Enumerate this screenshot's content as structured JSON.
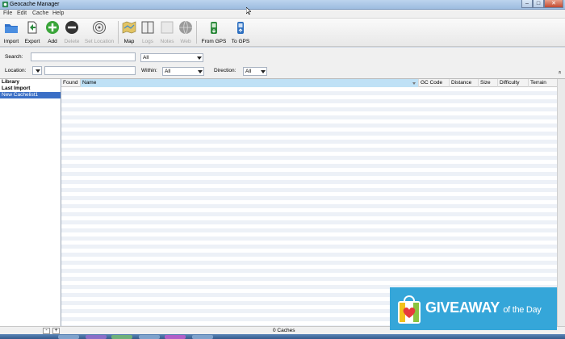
{
  "window": {
    "title": "Geocache Manager"
  },
  "menu": [
    "File",
    "Edit",
    "Cache",
    "Help"
  ],
  "toolbar": {
    "import": "Import",
    "export": "Export",
    "add": "Add",
    "delete": "Delete",
    "set_location": "Set Location",
    "map": "Map",
    "logs": "Logs",
    "notes": "Notes",
    "web": "Web",
    "from_gps": "From GPS",
    "to_gps": "To GPS"
  },
  "filters": {
    "search_label": "Search:",
    "search_value": "",
    "search_scope": "All",
    "location_label": "Location:",
    "location_value": "",
    "within_label": "Within:",
    "within_value": "All",
    "direction_label": "Direction:",
    "direction_value": "All",
    "collapse_glyph": "»"
  },
  "sidebar": {
    "items": [
      {
        "label": "Library"
      },
      {
        "label": "Last Import"
      },
      {
        "label": "New Cachelist1"
      }
    ]
  },
  "grid": {
    "columns": [
      "Found",
      "Name",
      "GC Code",
      "Distance",
      "Size",
      "Difficulty",
      "Terrain"
    ],
    "sorted_column": "Name"
  },
  "status": {
    "text": "0 Caches",
    "minus": "-",
    "plus": "+"
  },
  "banner": {
    "main": "GIVEAWAY",
    "suffix": "of the Day"
  },
  "colors": {
    "selection": "#3b6fc6",
    "banner": "#35a6d9",
    "sorted_header": "#bfe1f6"
  }
}
